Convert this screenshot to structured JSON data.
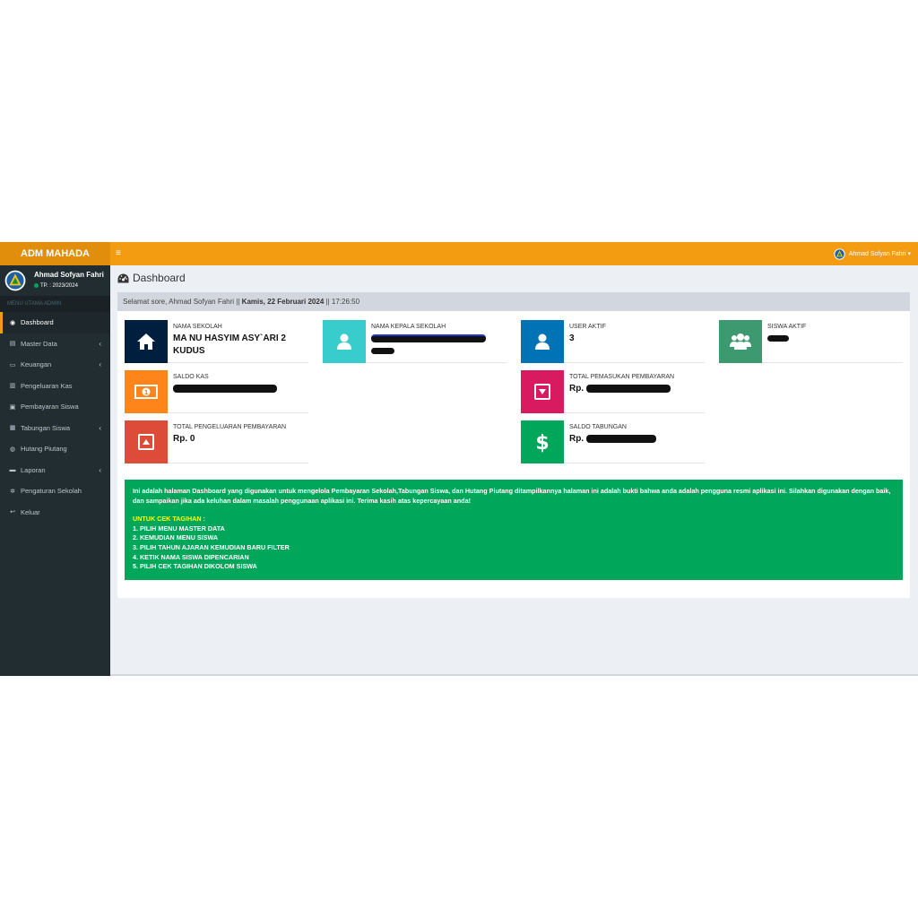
{
  "header": {
    "logo": "ADM MAHADA",
    "toggle": "≡",
    "user_label": "Ahmad Sofyan Fahri ▾"
  },
  "sidebar": {
    "user_name": "Ahmad Sofyan Fahri",
    "user_status": "TP. : 2023/2024",
    "section_label": "MENU UTAMA ADMIN",
    "items": [
      {
        "label": "Dashboard",
        "icon": "dashboard-icon",
        "glyph": "◉",
        "active": true,
        "chevron": false
      },
      {
        "label": "Master Data",
        "icon": "book-icon",
        "glyph": "▤",
        "active": false,
        "chevron": true
      },
      {
        "label": "Keuangan",
        "icon": "credit-card-icon",
        "glyph": "▭",
        "active": false,
        "chevron": true
      },
      {
        "label": "Pengeluaran Kas",
        "icon": "bar-chart-icon",
        "glyph": "▥",
        "active": false,
        "chevron": false
      },
      {
        "label": "Pembayaran Siswa",
        "icon": "money-icon",
        "glyph": "▣",
        "active": false,
        "chevron": false
      },
      {
        "label": "Tabungan Siswa",
        "icon": "book-open-icon",
        "glyph": "▦",
        "active": false,
        "chevron": true
      },
      {
        "label": "Hutang Piutang",
        "icon": "globe-icon",
        "glyph": "◍",
        "active": false,
        "chevron": false
      },
      {
        "label": "Laporan",
        "icon": "print-icon",
        "glyph": "▬",
        "active": false,
        "chevron": true
      },
      {
        "label": "Pengaturan Sekolah",
        "icon": "cogs-icon",
        "glyph": "✲",
        "active": false,
        "chevron": false
      },
      {
        "label": "Keluar",
        "icon": "reply-icon",
        "glyph": "↩",
        "active": false,
        "chevron": false
      }
    ]
  },
  "page": {
    "title": "Dashboard",
    "greeting_prefix": "Selamat sore, Ahmad Sofyan Fahri || ",
    "greeting_date": "Kamis, 22 Februari 2024",
    "greeting_time": " || 17:26:50"
  },
  "tiles": {
    "nama_sekolah": {
      "title": "NAMA SEKOLAH",
      "value": "MA NU HASYIM ASY`ARI 2 KUDUS",
      "color": "#001f3f",
      "icon": "home-icon"
    },
    "nama_kepala": {
      "title": "NAMA KEPALA SEKOLAH",
      "color": "#39cccc",
      "icon": "user-icon"
    },
    "user_aktif": {
      "title": "USER AKTIF",
      "value": "3",
      "color": "#0073b7",
      "icon": "user-icon"
    },
    "siswa_aktif": {
      "title": "SISWA AKTIF",
      "color": "#3d9970",
      "icon": "users-icon"
    },
    "saldo_kas": {
      "title": "SALDO KAS",
      "color": "#ff851b",
      "icon": "money-icon"
    },
    "total_pemasukan": {
      "title": "TOTAL PEMASUKAN PEMBAYARAN",
      "value": "Rp.",
      "color": "#d81b60",
      "icon": "caret-down-icon"
    },
    "total_pengeluaran": {
      "title": "TOTAL PENGELUARAN PEMBAYARAN",
      "value": "Rp. 0",
      "color": "#dd4b39",
      "icon": "caret-up-icon"
    },
    "saldo_tabungan": {
      "title": "SALDO TABUNGAN",
      "value": "Rp.",
      "color": "#00a65a",
      "icon": "dollar-icon"
    }
  },
  "callout": {
    "intro": "Ini adalah halaman Dashboard yang digunakan untuk mengelola Pembayaran Sekolah,Tabungan Siswa, dan Hutang Piutang ditampilkannya halaman ini adalah bukti bahwa anda adalah pengguna resmi aplikasi ini. Silahkan digunakan dengan baik, dan sampaikan jika ada keluhan dalam masalah penggunaan aplikasi ini. Terima kasih atas kepercayaan anda!",
    "heading": "UNTUK CEK TAGIHAN :",
    "steps": [
      "1. PILIH MENU MASTER DATA",
      "2. KEMUDIAN MENU SISWA",
      "3. PILIH TAHUN AJARAN KEMUDIAN BARU FILTER",
      "4. KETIK NAMA SISWA DIPENCARIAN",
      "5. PILIH CEK TAGIHAN DIKOLOM SISWA"
    ]
  }
}
